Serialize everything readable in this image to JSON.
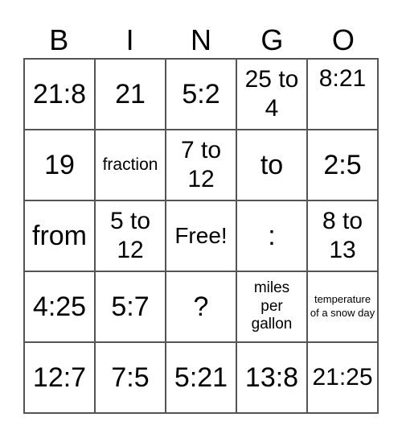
{
  "header": {
    "letters": [
      "B",
      "I",
      "N",
      "G",
      "O"
    ]
  },
  "cells": [
    [
      "21:8",
      "21",
      "5:2",
      "25 to 4",
      "8:21"
    ],
    [
      "19",
      "fraction",
      "7 to 12",
      "to",
      "2:5"
    ],
    [
      "from",
      "5 to 12",
      "Free!",
      ":",
      "8 to 13"
    ],
    [
      "4:25",
      "5:7",
      "?",
      "miles per gallon",
      "temperature of a snow day"
    ],
    [
      "12:7",
      "7:5",
      "5:21",
      "13:8",
      "21:25"
    ]
  ]
}
